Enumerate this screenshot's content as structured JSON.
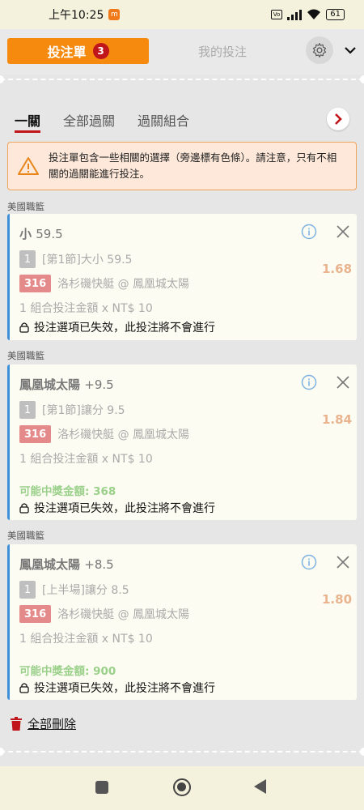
{
  "status_bar": {
    "time": "上午10:25",
    "battery": "61"
  },
  "header": {
    "tab_betslip": "投注單",
    "tab_betslip_count": "3",
    "tab_mybets": "我的投注"
  },
  "subtabs": [
    "一關",
    "全部過關",
    "過關組合"
  ],
  "warning": "投注單包含一些相關的選擇（旁邊標有色條）。請注意，只有不相關的過關能進行投注。",
  "bets": [
    {
      "league": "美國職籃",
      "selection": "小",
      "line": "59.5",
      "market_num": "1",
      "market": "[第1節]大小 59.5",
      "match_id": "316",
      "match": "洛杉磯快艇 @ 鳳凰城太陽",
      "odds": "1.68",
      "amount": "1 組合投注金額 x NT$ 10",
      "potential_win": "",
      "status": "投注選項已失效，此投注將不會進行"
    },
    {
      "league": "美國職籃",
      "selection": "鳳凰城太陽",
      "line": "+9.5",
      "market_num": "1",
      "market": "[第1節]讓分 9.5",
      "match_id": "316",
      "match": "洛杉磯快艇 @ 鳳凰城太陽",
      "odds": "1.84",
      "amount": "1 組合投注金額 x NT$ 10",
      "potential_win": "可能中獎金額: 368",
      "status": "投注選項已失效，此投注將不會進行"
    },
    {
      "league": "美國職籃",
      "selection": "鳳凰城太陽",
      "line": "+8.5",
      "market_num": "1",
      "market": "[上半場]讓分 8.5",
      "match_id": "316",
      "match": "洛杉磯快艇 @ 鳳凰城太陽",
      "odds": "1.80",
      "amount": "1 組合投注金額 x NT$ 10",
      "potential_win": "可能中獎金額: 900",
      "status": "投注選項已失效，此投注將不會進行"
    }
  ],
  "delete_all": "全部刪除",
  "colors": {
    "accent": "#f58a0f",
    "badge": "#c0151b",
    "card_bar": "#3d8fd8",
    "odds": "#e9b38d",
    "win": "#9ad08a"
  }
}
